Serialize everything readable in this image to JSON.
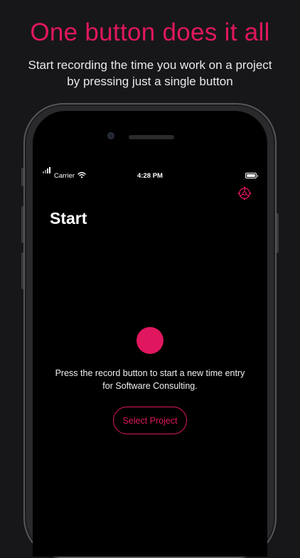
{
  "promo": {
    "headline": "One button does it all",
    "subline_line1": "Start recording the time you work on a project",
    "subline_line2": "by pressing just a single button"
  },
  "status_bar": {
    "carrier": "Carrier",
    "time": "4:28 PM",
    "icons": [
      "signal-icon",
      "wifi-icon",
      "battery-icon"
    ]
  },
  "app": {
    "title": "Start",
    "settings_icon": "gear-icon",
    "hint_line1": "Press the record button to start a new time entry",
    "hint_line2": "for Software Consulting.",
    "select_project_label": "Select Project"
  },
  "colors": {
    "accent": "#e0175f",
    "background": "#171719",
    "screen": "#000000",
    "text": "#ffffff"
  }
}
